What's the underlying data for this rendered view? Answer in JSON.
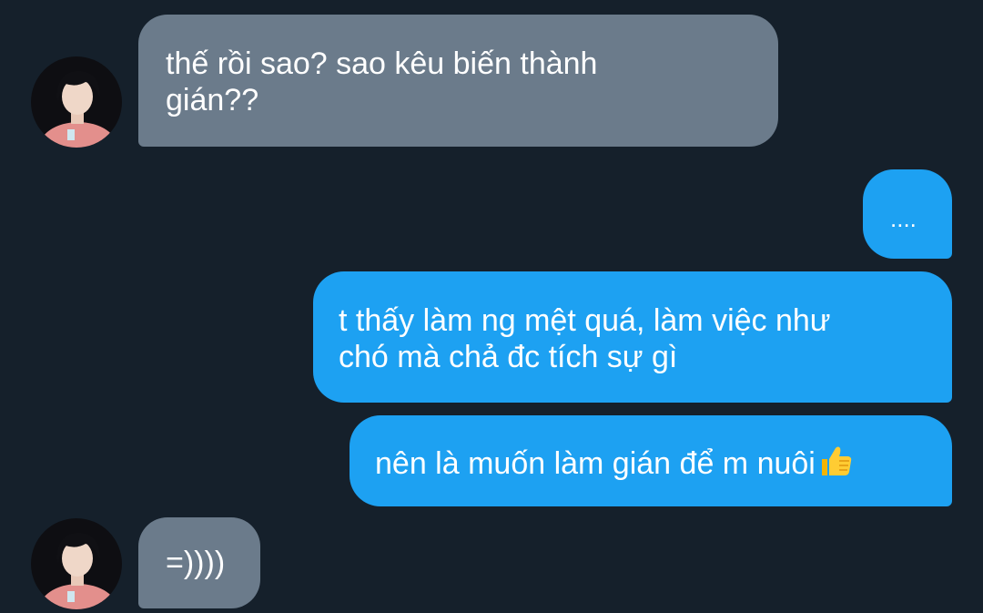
{
  "conversation": {
    "messages": [
      {
        "sender": "them",
        "text": "thế rồi sao? sao kêu biến thành\ngián??"
      },
      {
        "sender": "me",
        "text": "...."
      },
      {
        "sender": "me",
        "text": "t thấy làm ng mệt quá, làm việc như\nchó mà chả đc tích sự gì"
      },
      {
        "sender": "me",
        "text": "nên là muốn làm gián để m nuôi",
        "emoji": "thumbs-up-icon"
      },
      {
        "sender": "them",
        "text": "=))))"
      }
    ]
  },
  "colors": {
    "background": "#15202b",
    "incoming_bubble": "#6b7b8b",
    "outgoing_bubble": "#1da1f2",
    "text": "#ffffff"
  }
}
